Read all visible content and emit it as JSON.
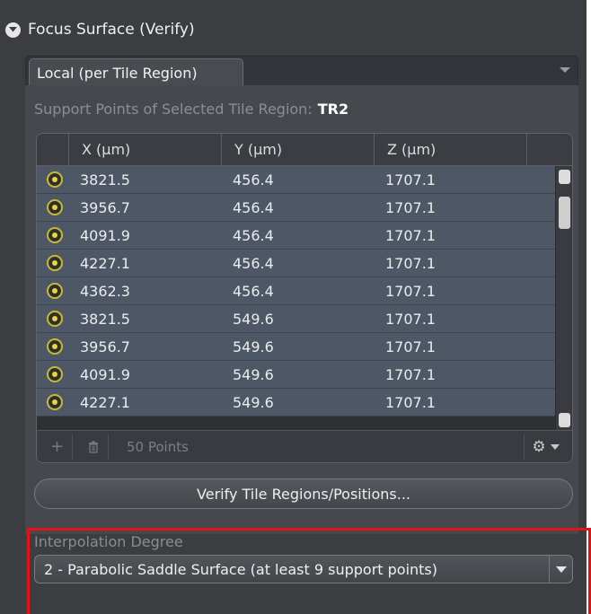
{
  "section": {
    "title": "Focus Surface (Verify)",
    "expand_icon": "circle-chevron-down-icon"
  },
  "tabs": [
    {
      "label": "Local (per Tile Region)",
      "active": true
    }
  ],
  "support_points": {
    "label": "Support Points of Selected Tile Region:",
    "region": "TR2"
  },
  "table": {
    "columns": [
      "X (µm)",
      "Y (µm)",
      "Z (µm)"
    ],
    "rows": [
      {
        "x": "3821.5",
        "y": "456.4",
        "z": "1707.1"
      },
      {
        "x": "3956.7",
        "y": "456.4",
        "z": "1707.1"
      },
      {
        "x": "4091.9",
        "y": "456.4",
        "z": "1707.1"
      },
      {
        "x": "4227.1",
        "y": "456.4",
        "z": "1707.1"
      },
      {
        "x": "4362.3",
        "y": "456.4",
        "z": "1707.1"
      },
      {
        "x": "3821.5",
        "y": "549.6",
        "z": "1707.1"
      },
      {
        "x": "3956.7",
        "y": "549.6",
        "z": "1707.1"
      },
      {
        "x": "4091.9",
        "y": "549.6",
        "z": "1707.1"
      },
      {
        "x": "4227.1",
        "y": "549.6",
        "z": "1707.1"
      }
    ],
    "row_icon": "focus-point-icon",
    "footer": {
      "add_symbol": "+",
      "delete_icon": "trash-icon",
      "points_count": "50 Points",
      "settings_icon": "gear-icon"
    }
  },
  "verify_button": {
    "label": "Verify Tile Regions/Positions..."
  },
  "interpolation": {
    "label": "Interpolation Degree",
    "selected": "2 - Parabolic Saddle Surface (at least 9 support points)"
  },
  "colors": {
    "panel_bg": "#3c3d41",
    "row_bg": "#4d5765",
    "point_icon": "#e6d548",
    "highlight": "#e01414"
  }
}
